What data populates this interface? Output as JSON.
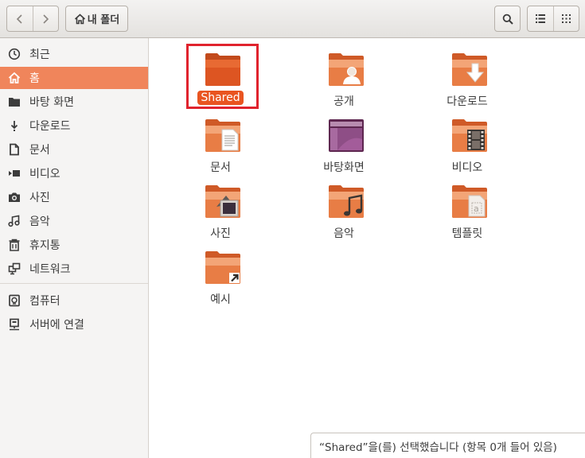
{
  "header": {
    "back_icon": "chevron-left-icon",
    "forward_icon": "chevron-right-icon",
    "location_label": "내 폴더",
    "location_icon": "home-icon",
    "search_icon": "search-icon",
    "list_view_icon": "list-view-icon",
    "grid_view_icon": "grid-view-icon"
  },
  "sidebar": {
    "items": [
      {
        "label": "최근",
        "icon": "clock-icon"
      },
      {
        "label": "홈",
        "icon": "home-icon",
        "active": true
      },
      {
        "label": "바탕 화면",
        "icon": "folder-icon"
      },
      {
        "label": "다운로드",
        "icon": "download-icon"
      },
      {
        "label": "문서",
        "icon": "document-icon"
      },
      {
        "label": "비디오",
        "icon": "video-icon"
      },
      {
        "label": "사진",
        "icon": "camera-icon"
      },
      {
        "label": "음악",
        "icon": "music-icon"
      },
      {
        "label": "휴지통",
        "icon": "trash-icon"
      },
      {
        "label": "네트워크",
        "icon": "network-icon"
      },
      {
        "label": "컴퓨터",
        "icon": "computer-icon"
      },
      {
        "label": "서버에 연결",
        "icon": "server-icon"
      }
    ]
  },
  "content": {
    "folders": [
      {
        "label": "Shared",
        "icon": "shared-folder-icon",
        "selected": true
      },
      {
        "label": "공개",
        "icon": "public-folder-icon"
      },
      {
        "label": "다운로드",
        "icon": "downloads-folder-icon"
      },
      {
        "label": "문서",
        "icon": "documents-folder-icon"
      },
      {
        "label": "바탕화면",
        "icon": "desktop-folder-icon"
      },
      {
        "label": "비디오",
        "icon": "videos-folder-icon"
      },
      {
        "label": "사진",
        "icon": "pictures-folder-icon"
      },
      {
        "label": "음악",
        "icon": "music-folder-icon"
      },
      {
        "label": "템플릿",
        "icon": "templates-folder-icon"
      },
      {
        "label": "예시",
        "icon": "examples-folder-icon"
      }
    ]
  },
  "status": {
    "text": "“Shared”을(를) 선택했습니다  (항목 0개 들어 있음)"
  },
  "colors": {
    "accent": "#e95420",
    "sidebar_active": "#f0855b",
    "highlight_box": "#e0232d",
    "folder_orange": "#e8753a"
  }
}
